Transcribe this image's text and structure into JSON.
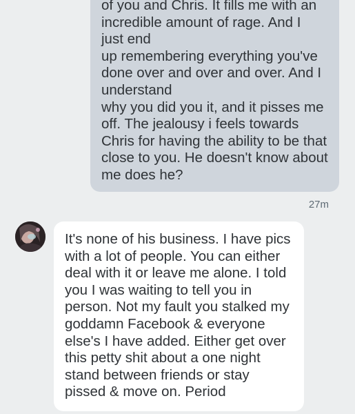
{
  "conversation": {
    "outgoing_message": {
      "lines": [
        "of you and Chris. It fills me with an",
        "incredible amount of rage. And I",
        "just end",
        "up remembering everything you've",
        "done over and over and over. And I",
        "understand",
        "why you did you it, and it pisses me",
        "off. The jealousy i feels towards",
        "Chris for having the ability to be that",
        "close to you. He doesn't know about",
        "me does he?"
      ],
      "timestamp": "27m"
    },
    "incoming_message": {
      "avatar_icon": "profile-photo-icon",
      "lines": [
        "It's none of his business. I have pics",
        "with a lot of people. You can either",
        "deal with it or leave me alone. I told",
        "you I was waiting to tell you in",
        "person. Not my fault you stalked my",
        "goddamn Facebook & everyone",
        "else's I have added. Either get over",
        "this petty shit about a one night",
        "stand between friends or stay",
        "pissed & move on. Period"
      ]
    }
  },
  "colors": {
    "background": "#eceeef",
    "outgoing_bubble": "#cfd5dc",
    "incoming_bubble": "#ffffff",
    "text": "#2f3337",
    "timestamp": "#5f6b75"
  }
}
